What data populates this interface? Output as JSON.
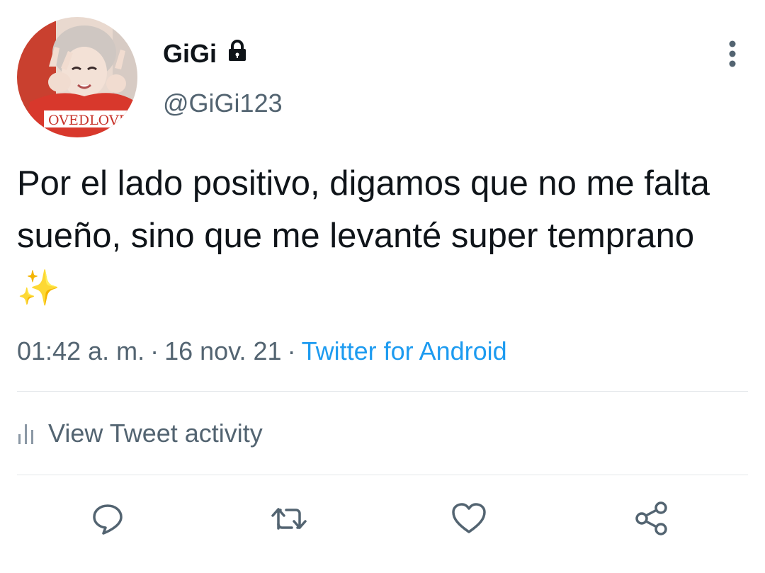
{
  "user": {
    "display_name": "GiGi",
    "handle": "@GiGi123",
    "protected_icon": "lock-icon",
    "avatar_shirt_text": "OVEDLOVE"
  },
  "tweet": {
    "text": "Por el lado positivo, digamos que no me falta sueño, sino que me levanté super temprano ✨",
    "time": "01:42 a. m.",
    "separator": "·",
    "date": "16 nov. 21",
    "source": "Twitter for Android"
  },
  "activity": {
    "label": "View Tweet activity",
    "icon": "bar-chart-icon"
  },
  "actions": {
    "reply_icon": "comment-icon",
    "retweet_icon": "retweet-icon",
    "like_icon": "heart-icon",
    "share_icon": "share-icon"
  },
  "colors": {
    "text_primary": "#0f1419",
    "text_secondary": "#536471",
    "link": "#1d9bf0",
    "icon": "#536471",
    "divider": "#e3e7ea"
  }
}
